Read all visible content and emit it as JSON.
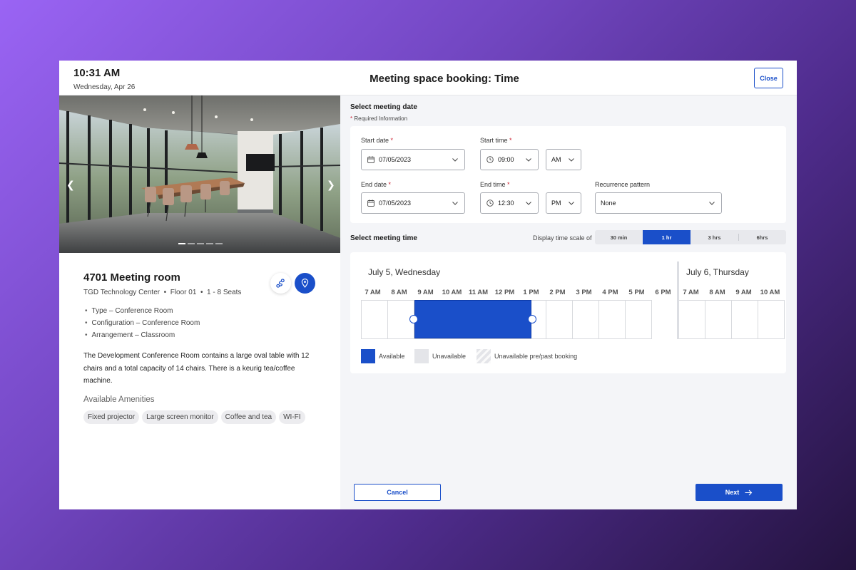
{
  "header": {
    "time": "10:31 AM",
    "date": "Wednesday, Apr 26",
    "title": "Meeting space booking: Time",
    "close_label": "Close"
  },
  "room": {
    "name": "4701 Meeting room",
    "location": "TGD Technology Center",
    "floor": "Floor 01",
    "seats": "1 - 8 Seats",
    "features": [
      "Type – Conference Room",
      "Configuration – Conference Room",
      "Arrangement – Classroom"
    ],
    "description": "The Development Conference Room contains a large oval table with 12 chairs and a total capacity of 14 chairs.  There is a keurig tea/coffee machine.",
    "amenities_title": "Available Amenities",
    "amenities": [
      "Fixed projector",
      "Large screen monitor",
      "Coffee and tea",
      "WI-FI"
    ],
    "carousel": {
      "slides": 5,
      "active_index": 0
    },
    "icons": {
      "route": "route-icon",
      "map": "map-pin-icon",
      "prev": "chevron-left-icon",
      "next": "chevron-right-icon"
    }
  },
  "date_section": {
    "title": "Select meeting date",
    "required_marker": "*",
    "required_note": "Required Information",
    "start_date_label": "Start date",
    "start_date": "07/05/2023",
    "start_time_label": "Start time",
    "start_time": "09:00",
    "start_ampm": "AM",
    "end_date_label": "End date",
    "end_date": "07/05/2023",
    "end_time_label": "End time",
    "end_time": "12:30",
    "end_ampm": "PM",
    "recurrence_label": "Recurrence pattern",
    "recurrence": "None"
  },
  "time_section": {
    "title": "Select meeting time",
    "scale_label": "Display time scale of",
    "scale_options": [
      "30 min",
      "1 hr",
      "3 hrs",
      "6hrs"
    ],
    "scale_selected": "1 hr",
    "day1": {
      "heading": "July 5, Wednesday",
      "hours": [
        "7 AM",
        "8 AM",
        "9 AM",
        "10 AM",
        "11 AM",
        "12 PM",
        "1 PM",
        "2 PM",
        "3 PM",
        "4 PM",
        "5 PM",
        "6 PM"
      ]
    },
    "day2": {
      "heading": "July 6, Thursday",
      "hours": [
        "7 AM",
        "8 AM",
        "9 AM",
        "10 AM"
      ]
    },
    "booking": {
      "start": "9 AM",
      "end": "1 PM"
    },
    "legend": [
      "Available",
      "Unavailable",
      "Unavailable pre/past booking"
    ]
  },
  "footer": {
    "cancel_label": "Cancel",
    "next_label": "Next"
  },
  "colors": {
    "accent": "#1a4fc9",
    "unavailable": "#e4e5e9",
    "required": "#cc2233"
  }
}
